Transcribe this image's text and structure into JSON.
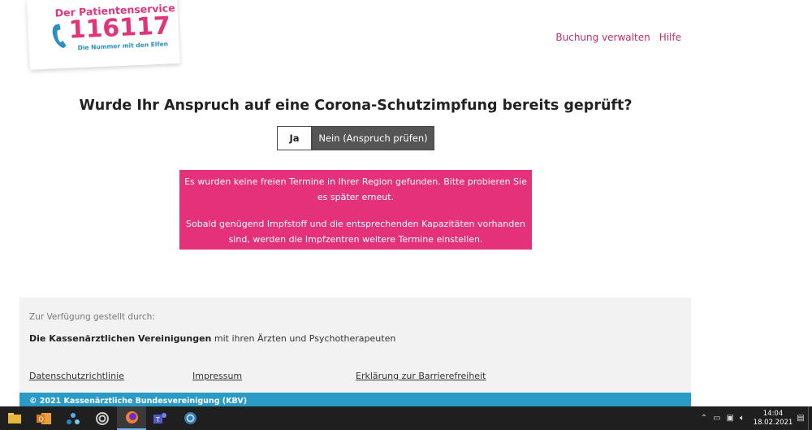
{
  "logo": {
    "title": "Der Patientenservice",
    "number": "116117",
    "subtitle": "Die Nummer mit den Elfen"
  },
  "header": {
    "links": [
      "Buchung verwalten",
      "Hilfe"
    ]
  },
  "colors": {
    "brand_pink": "#e5317a",
    "link_pink": "#c22f6c",
    "toggle_dark": "#555555",
    "footer_bg": "#f2f2f2",
    "copyright_blue": "#2a9bc4"
  },
  "question": {
    "text": "Wurde Ihr Anspruch auf eine Corona-Schutzimpfung bereits geprüft?",
    "option_yes": "Ja",
    "option_no": "Nein (Anspruch prüfen)",
    "selected": "Nein (Anspruch prüfen)"
  },
  "alert": {
    "line1": "Es wurden keine freien Termine in Ihrer Region gefunden. Bitte probieren Sie es später erneut.",
    "line2": "Sobald genügend Impfstoff und die entsprechenden Kapazitäten vorhanden sind, werden die Impfzentren weitere Termine einstellen."
  },
  "footer": {
    "provided_by": "Zur Verfügung gestellt durch:",
    "org_bold": "Die Kassenärztlichen Vereinigungen",
    "org_rest": " mit ihren Ärzten und Psychotherapeuten",
    "links": [
      "Datenschutzrichtlinie",
      "Impressum",
      "Erklärung zur Barrierefreiheit"
    ],
    "copyright": "© 2021 Kassenärztliche Bundesvereinigung (KBV)"
  },
  "taskbar": {
    "apps": [
      "file-explorer-icon",
      "outlook-icon",
      "network-app-icon",
      "target-app-icon",
      "firefox-icon",
      "teams-icon",
      "circle-app-icon"
    ],
    "time": "14:04",
    "date": "18.02.2021"
  }
}
